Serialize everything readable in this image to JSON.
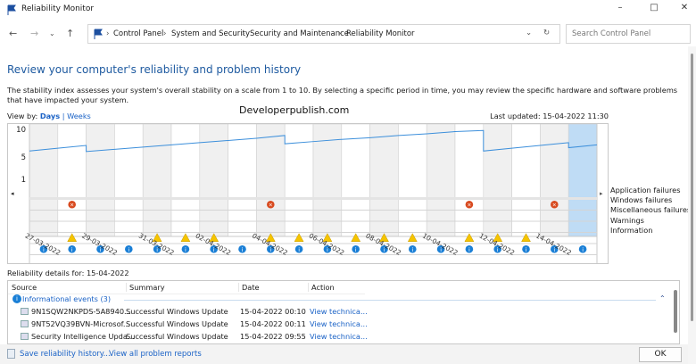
{
  "window": {
    "title": "Reliability Monitor"
  },
  "address": {
    "breadcrumb": [
      "Control Panel",
      "System and Security",
      "Security and Maintenance",
      "Reliability Monitor"
    ],
    "search_placeholder": "Search Control Panel"
  },
  "main": {
    "heading": "Review your computer's reliability and problem history",
    "description": "The stability index assesses your system's overall stability on a scale from 1 to 10. By selecting a specific period in time, you may review the specific hardware and software problems that have impacted your system.",
    "view_by_label": "View by:",
    "view_days": "Days",
    "view_sep": "|",
    "view_weeks": "Weeks",
    "watermark": "Developerpublish.com",
    "last_updated": "Last updated: 15-04-2022 11:30"
  },
  "chart_data": {
    "type": "line",
    "y_ticks": [
      "10",
      "5",
      "1"
    ],
    "ylim": [
      1,
      10
    ],
    "dates": [
      "27-03-2022",
      "28-03-2022",
      "29-03-2022",
      "30-03-2022",
      "31-03-2022",
      "01-04-2022",
      "02-04-2022",
      "03-04-2022",
      "04-04-2022",
      "05-04-2022",
      "06-04-2022",
      "07-04-2022",
      "08-04-2022",
      "09-04-2022",
      "10-04-2022",
      "11-04-2022",
      "12-04-2022",
      "13-04-2022",
      "14-04-2022",
      "15-04-2022"
    ],
    "date_labels": [
      "27-03-2022",
      "29-03-2022",
      "31-03-2022",
      "02-04-2022",
      "04-04-2022",
      "06-04-2022",
      "08-04-2022",
      "10-04-2022",
      "12-04-2022",
      "14-04-2022"
    ],
    "stability_start": [
      6.1,
      6.6,
      6.0,
      6.4,
      6.8,
      7.2,
      7.6,
      8.0,
      8.4,
      7.4,
      7.8,
      8.2,
      8.5,
      8.9,
      9.2,
      9.6,
      6.1,
      6.6,
      7.1,
      6.7
    ],
    "stability_end": [
      6.6,
      7.1,
      6.4,
      6.8,
      7.2,
      7.6,
      8.0,
      8.4,
      8.9,
      7.8,
      8.2,
      8.5,
      8.9,
      9.2,
      9.6,
      9.8,
      6.6,
      7.1,
      7.6,
      7.2
    ],
    "drop_days": [
      1,
      8,
      15,
      18
    ],
    "selected_day": "15-04-2022",
    "rows": [
      "Application failures",
      "Windows failures",
      "Miscellaneous failures",
      "Warnings",
      "Information"
    ],
    "application_failures": [
      1,
      8,
      15,
      18
    ],
    "windows_failures": [],
    "misc_failures": [],
    "warnings": [
      1,
      4,
      5,
      6,
      8,
      9,
      10,
      11,
      12,
      13,
      15,
      16,
      17
    ],
    "information": [
      0,
      1,
      2,
      3,
      4,
      5,
      6,
      7,
      8,
      9,
      10,
      11,
      12,
      13,
      14,
      15,
      16,
      17,
      18,
      19
    ],
    "colors": {
      "line": "#3c8fdb",
      "shade": "#f0f0f0",
      "selected": "#bfdcf5",
      "error": "#d84a1f",
      "warning": "#f5c400",
      "info": "#1a7fd6"
    }
  },
  "details": {
    "label": "Reliability details for: 15-04-2022",
    "columns": [
      "Source",
      "Summary",
      "Date",
      "Action"
    ],
    "group": "Informational events (3)",
    "rows": [
      {
        "source": "9N1SQW2NKPDS-5A8940...",
        "summary": "Successful Windows Update",
        "date": "15-04-2022 00:10",
        "action": "View technica..."
      },
      {
        "source": "9NT52VQ39BVN-Microsof...",
        "summary": "Successful Windows Update",
        "date": "15-04-2022 00:11",
        "action": "View technica..."
      },
      {
        "source": "Security Intelligence Upda...",
        "summary": "Successful Windows Update",
        "date": "15-04-2022 09:55",
        "action": "View technica..."
      }
    ]
  },
  "footer": {
    "save": "Save reliability history...",
    "view_all": "View all problem reports",
    "ok": "OK"
  }
}
